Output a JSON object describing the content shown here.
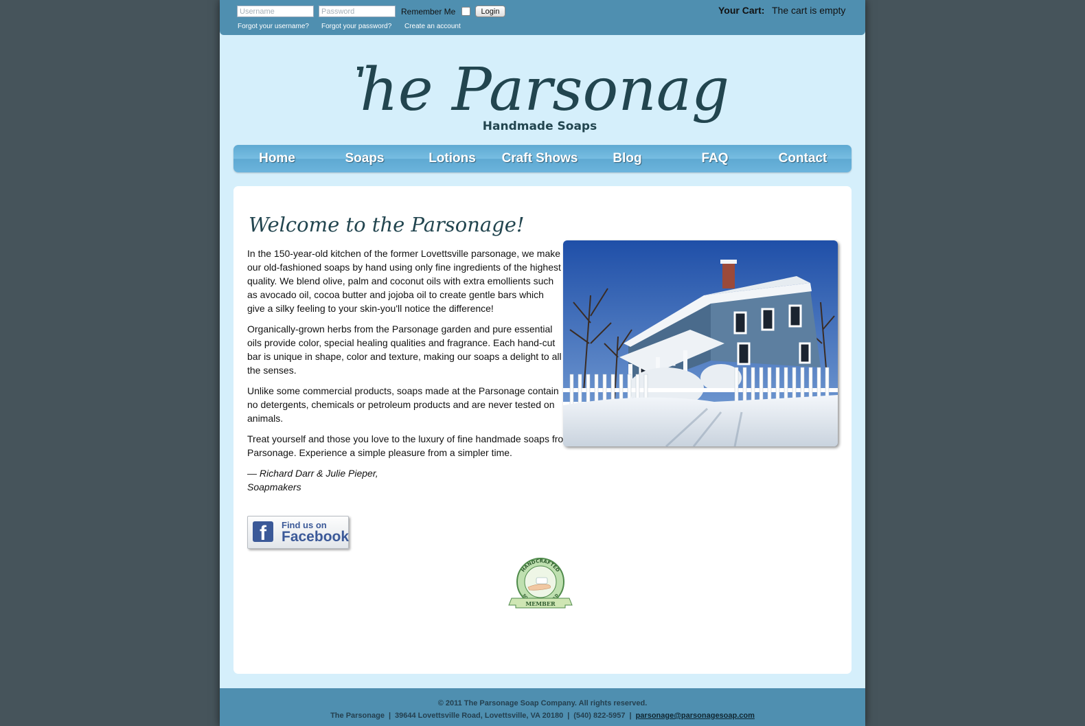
{
  "login": {
    "username_placeholder": "Username",
    "password_placeholder": "Password",
    "remember_label": "Remember Me",
    "login_label": "Login",
    "forgot_username": "Forgot your username?",
    "forgot_password": "Forgot your password?",
    "create_account": "Create an account"
  },
  "cart": {
    "label": "Your Cart:",
    "status": "The cart is empty"
  },
  "logo": {
    "title": "The Parsonage",
    "subtitle": "Handmade Soaps"
  },
  "nav": {
    "items": [
      {
        "label": "Home"
      },
      {
        "label": "Soaps"
      },
      {
        "label": "Lotions"
      },
      {
        "label": "Craft Shows"
      },
      {
        "label": "Blog"
      },
      {
        "label": "FAQ"
      },
      {
        "label": "Contact"
      }
    ]
  },
  "main": {
    "heading": "Welcome to the Parsonage!",
    "paragraphs": [
      "In the 150-year-old kitchen of the former Lovettsville parsonage, we make our old-fashioned soaps by hand using only fine ingredients of the highest quality. We blend olive, palm and coconut oils with extra emollients such as avocado oil, cocoa butter and jojoba oil to create gentle bars which give a silky feeling to your skin-you'll notice the difference!",
      "Organically-grown herbs from the Parsonage garden and pure essential oils provide color, special healing qualities and fragrance. Each hand-cut bar is unique in shape, color and texture, making our soaps a delight to all the senses.",
      "Unlike some commercial products, soaps made at the Parsonage contain no detergents, chemicals or petroleum products and are never tested on animals.",
      "Treat yourself and those you love to the luxury of fine handmade soaps from The Parsonage. Experience a simple pleasure from a simpler time."
    ],
    "signature_line1": "— Richard Darr & Julie Pieper,",
    "signature_line2": "Soapmakers"
  },
  "facebook": {
    "find": "Find us on",
    "name": "Facebook"
  },
  "badge": {
    "top_text": "HANDCRAFTED",
    "bottom_text": "SOAPMAKERS GUILD",
    "ribbon": "MEMBER"
  },
  "footer": {
    "copyright": "© 2011 The Parsonage Soap Company. All rights reserved.",
    "name": "The Parsonage",
    "address": "39644 Lovettsville Road, Lovettsville, VA 20180",
    "phone": "(540) 822-5957",
    "email": "parsonage@parsonagesoap.com"
  },
  "colors": {
    "page_bg": "#46545b",
    "wrap_bg": "#d5effb",
    "bar_blue": "#4f8fb0",
    "nav_blue": "#6cb4dc",
    "logo_ink": "#22454f"
  }
}
